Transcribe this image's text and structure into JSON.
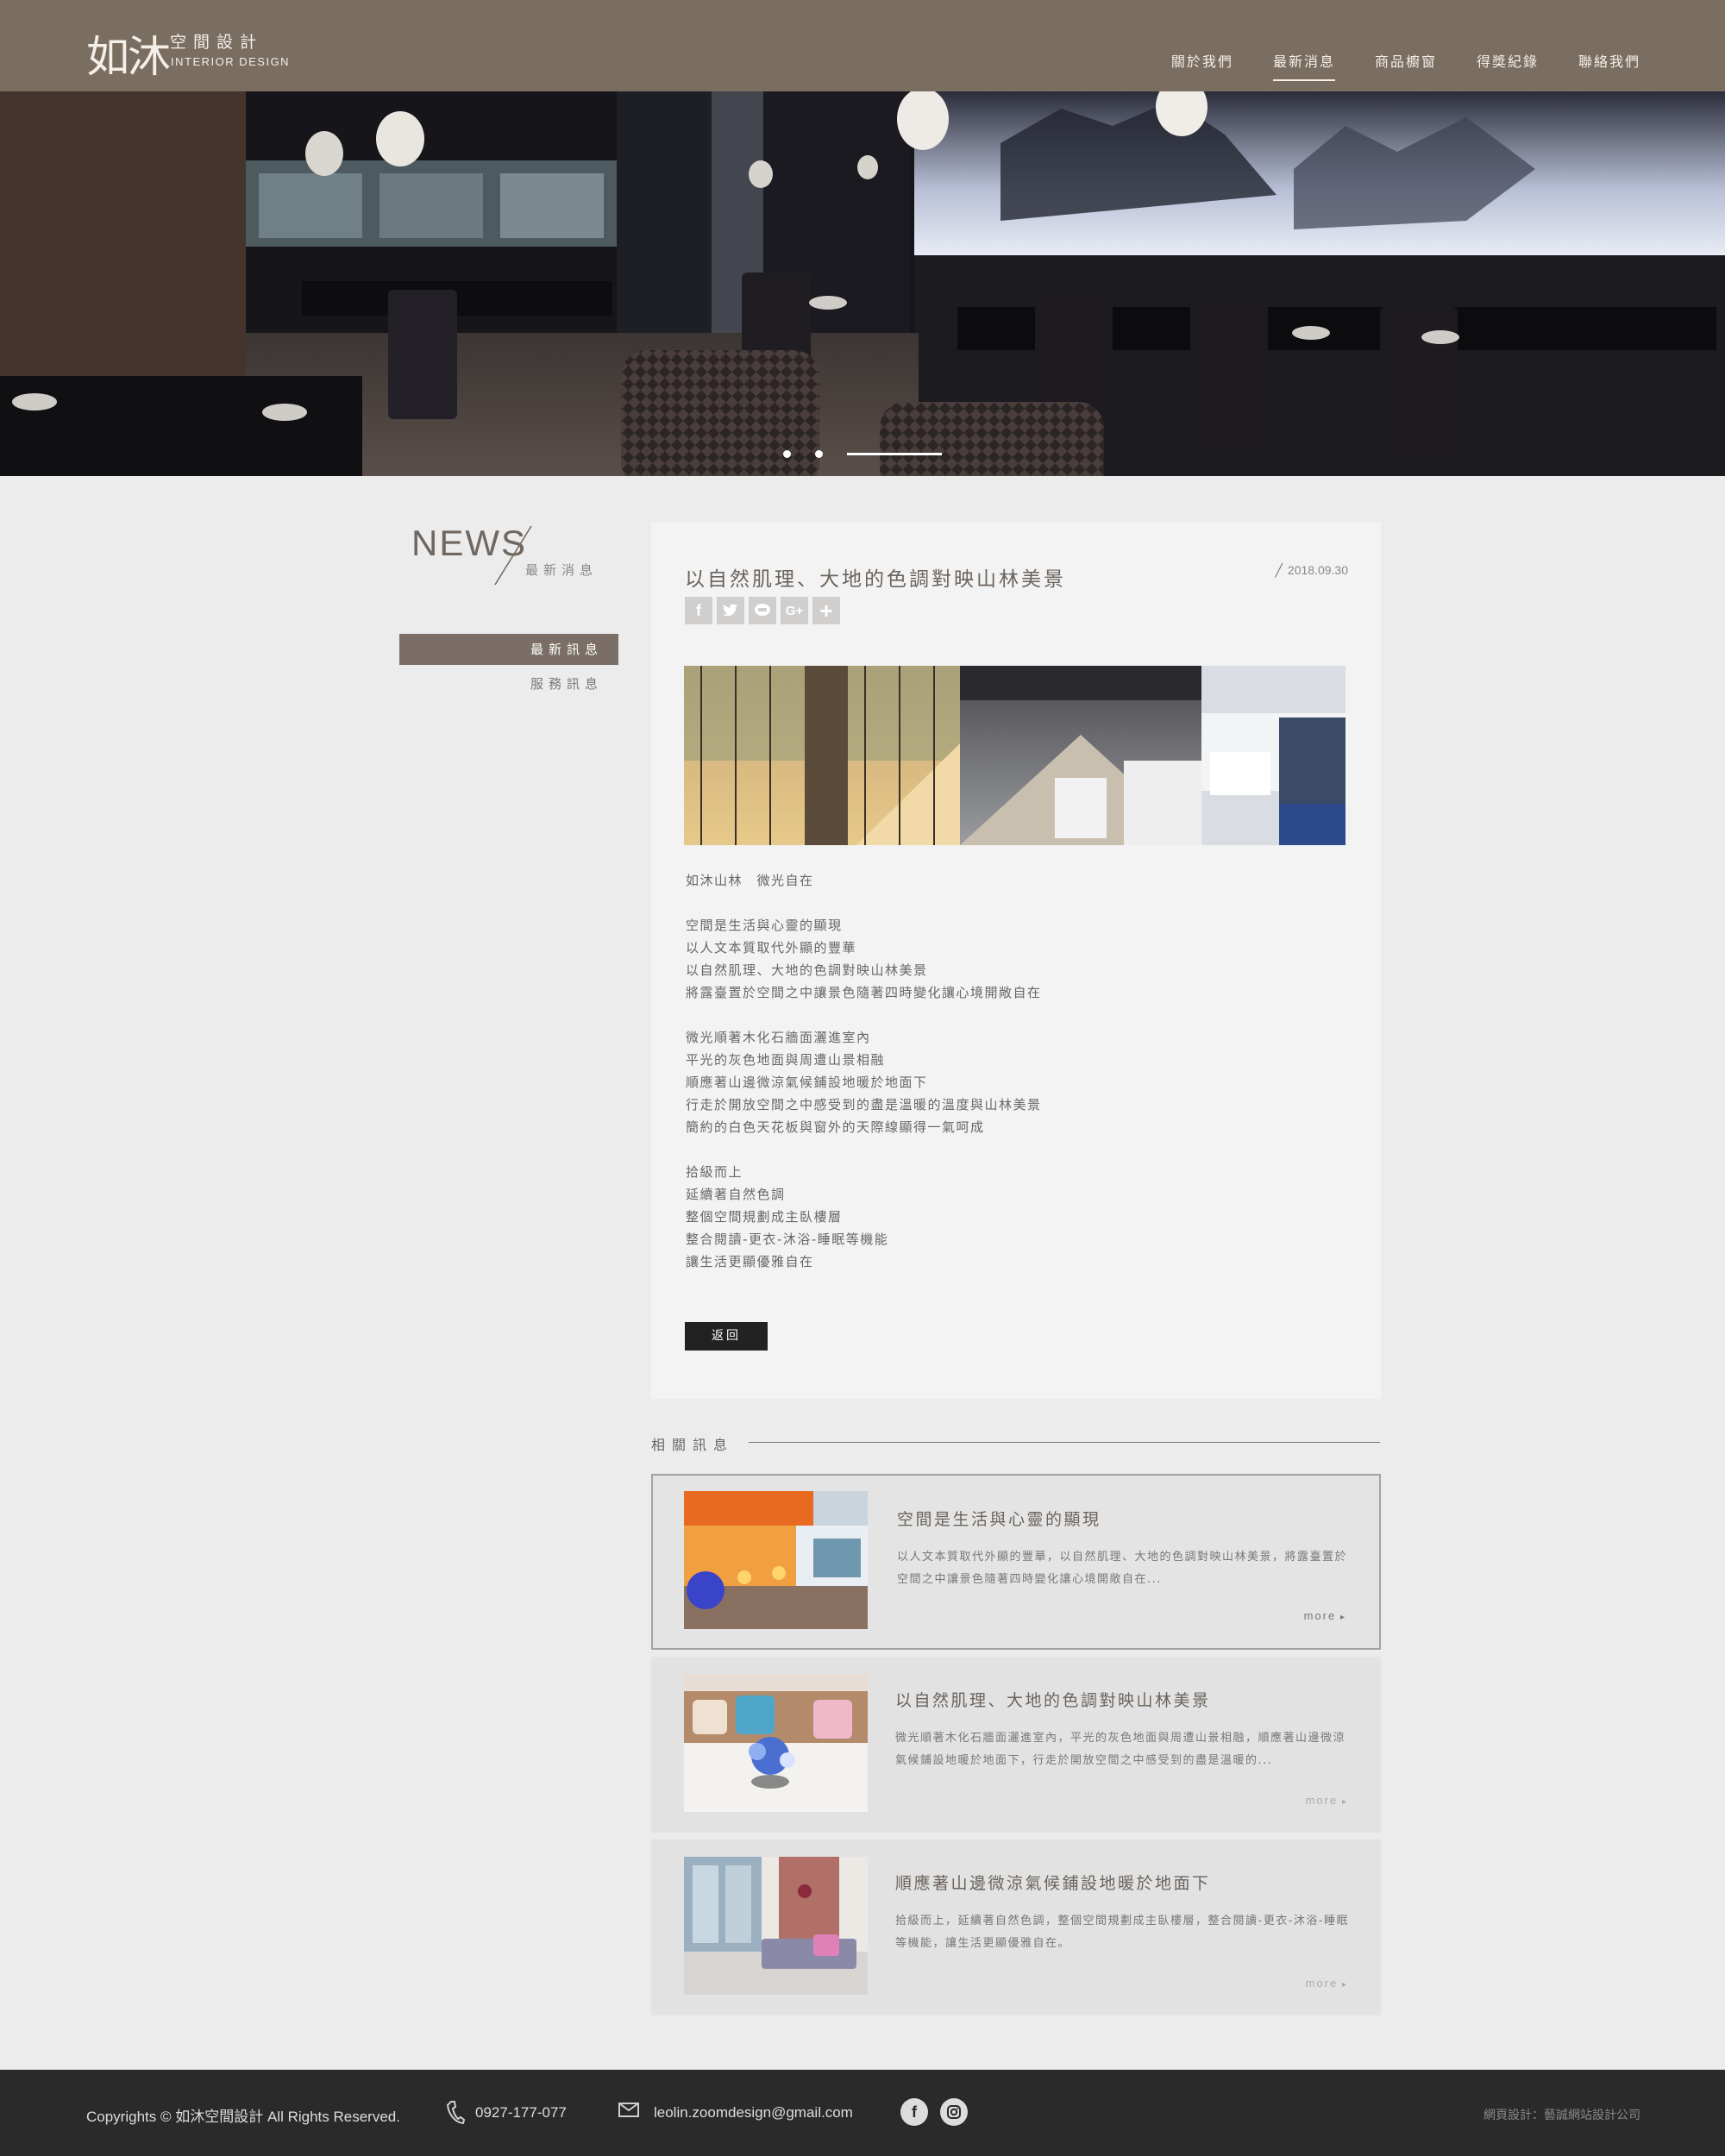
{
  "header": {
    "logo_cjk": "如沐",
    "logo_sub": "空間設計",
    "logo_en": "INTERIOR DESIGN",
    "nav": [
      "關於我們",
      "最新消息",
      "商品櫥窗",
      "得獎紀錄",
      "聯絡我們"
    ],
    "nav_active": "最新消息"
  },
  "hero": {
    "slides": 3,
    "active_slide": 3
  },
  "sidebar": {
    "title": "NEWS",
    "subtitle": "最新消息",
    "menu": [
      "最新訊息",
      "服務訊息"
    ],
    "menu_active": "最新訊息"
  },
  "article": {
    "title": "以自然肌理、大地的色調對映山林美景",
    "date": "2018.09.30",
    "share_icons": [
      "facebook-icon",
      "twitter-icon",
      "line-icon",
      "google-plus-icon",
      "plus-icon"
    ],
    "body": [
      "如沐山林　微光自在",
      "",
      "空間是生活與心靈的顯現",
      "以人文本質取代外顯的豐華",
      "以自然肌理、大地的色調對映山林美景",
      "將露臺置於空間之中讓景色隨著四時變化讓心境開敞自在",
      "",
      "微光順著木化石牆面灑進室內",
      "平光的灰色地面與周遭山景相融",
      "順應著山邊微涼氣候鋪設地暖於地面下",
      "行走於開放空間之中感受到的盡是溫暖的溫度與山林美景",
      "簡約的白色天花板與窗外的天際線顯得一氣呵成",
      "",
      "拾級而上",
      "延續著自然色調",
      "整個空間規劃成主臥樓層",
      "整合閱讀-更衣-沐浴-睡眠等機能",
      "讓生活更顯優雅自在"
    ],
    "back_label": "返回"
  },
  "related": {
    "heading": "相關訊息",
    "items": [
      {
        "title": "空間是生活與心靈的顯現",
        "excerpt": "以人文本質取代外顯的豐華，以自然肌理、大地的色調對映山林美景，將露臺置於空間之中讓景色隨著四時變化讓心境開敞自在...",
        "more": "more"
      },
      {
        "title": "以自然肌理、大地的色調對映山林美景",
        "excerpt": "微光順著木化石牆面灑進室內，平光的灰色地面與周遭山景相融，順應著山邊微涼氣候鋪設地暖於地面下，行走於開放空間之中感受到的盡是溫暖的...",
        "more": "more"
      },
      {
        "title": "順應著山邊微涼氣候鋪設地暖於地面下",
        "excerpt": "拾級而上，延續著自然色調，整個空間規劃成主臥樓層，整合閱讀-更衣-沐浴-睡眠等機能，讓生活更顯優雅自在。",
        "more": "more"
      }
    ]
  },
  "footer": {
    "copyright": "Copyrights © 如沐空間設計 All Rights Reserved.",
    "phone": "0927-177-077",
    "email": "leolin.zoomdesign@gmail.com",
    "social": [
      "facebook-icon",
      "instagram-icon"
    ],
    "credit": "網頁設計：藝誠網站設計公司"
  },
  "colors": {
    "header_bg": "#7a6e60",
    "accent": "#7a6e66",
    "footer_bg": "#2b2a2a",
    "page_bg": "#ececec"
  }
}
